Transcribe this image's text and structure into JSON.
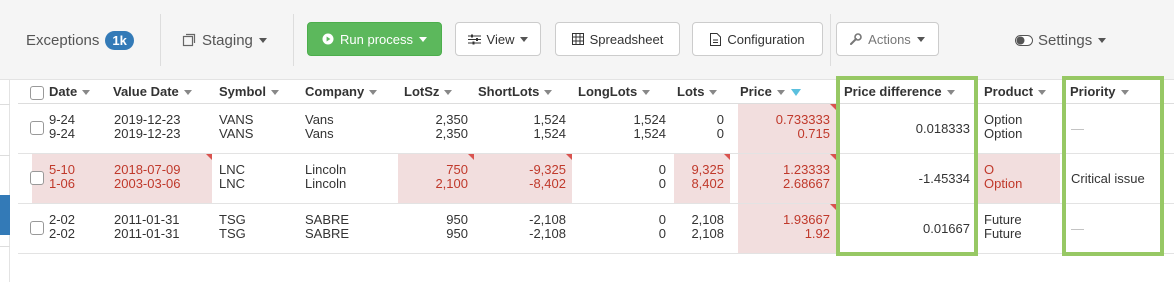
{
  "toolbar": {
    "exceptions_label": "Exceptions",
    "exceptions_badge": "1k",
    "staging_label": "Staging",
    "run_label": "Run process",
    "view_label": "View",
    "spreadsheet_label": "Spreadsheet",
    "configuration_label": "Configuration",
    "actions_label": "Actions",
    "settings_label": "Settings"
  },
  "columns": {
    "date": "Date",
    "value_date": "Value Date",
    "symbol": "Symbol",
    "company": "Company",
    "lotsz": "LotSz",
    "shortlots": "ShortLots",
    "longlots": "LongLots",
    "lots": "Lots",
    "price": "Price",
    "price_diff": "Price difference",
    "product": "Product",
    "priority": "Priority"
  },
  "rows": [
    {
      "date": [
        "9-24",
        "9-24"
      ],
      "value_date": [
        "2019-12-23",
        "2019-12-23"
      ],
      "symbol": [
        "VANS",
        "VANS"
      ],
      "company": [
        "Vans",
        "Vans"
      ],
      "lotsz": [
        "2,350",
        "2,350"
      ],
      "shortlots": [
        "1,524",
        "1,524"
      ],
      "longlots": [
        "1,524",
        "1,524"
      ],
      "lots": [
        "0",
        "0"
      ],
      "price": [
        "0.733333",
        "0.715"
      ],
      "price_diff": "0.018333",
      "product": [
        "Option",
        "Option"
      ],
      "priority": "—"
    },
    {
      "date": [
        "5-10",
        "1-06"
      ],
      "value_date": [
        "2018-07-09",
        "2003-03-06"
      ],
      "symbol": [
        "LNC",
        "LNC"
      ],
      "company": [
        "Lincoln",
        "Lincoln"
      ],
      "lotsz": [
        "750",
        "2,100"
      ],
      "shortlots": [
        "-9,325",
        "-8,402"
      ],
      "longlots": [
        "0",
        "0"
      ],
      "lots": [
        "9,325",
        "8,402"
      ],
      "price": [
        "1.23333",
        "2.68667"
      ],
      "price_diff": "-1.45334",
      "product": [
        "O",
        "Option"
      ],
      "priority": "Critical issue"
    },
    {
      "date": [
        "2-02",
        "2-02"
      ],
      "value_date": [
        "2011-01-31",
        "2011-01-31"
      ],
      "symbol": [
        "TSG",
        "TSG"
      ],
      "company": [
        "SABRE",
        "SABRE"
      ],
      "lotsz": [
        "950",
        "950"
      ],
      "shortlots": [
        "-2,108",
        "-2,108"
      ],
      "longlots": [
        "0",
        "0"
      ],
      "lots": [
        "2,108",
        "2,108"
      ],
      "price": [
        "1.93667",
        "1.92"
      ],
      "price_diff": "0.01667",
      "product": [
        "Future",
        "Future"
      ],
      "priority": "—"
    }
  ],
  "colors": {
    "accent": "#337ab7",
    "run_green": "#5cb85c",
    "highlight_green": "#97c864",
    "error_bg": "#f2dede",
    "error_text": "#c0392b"
  }
}
